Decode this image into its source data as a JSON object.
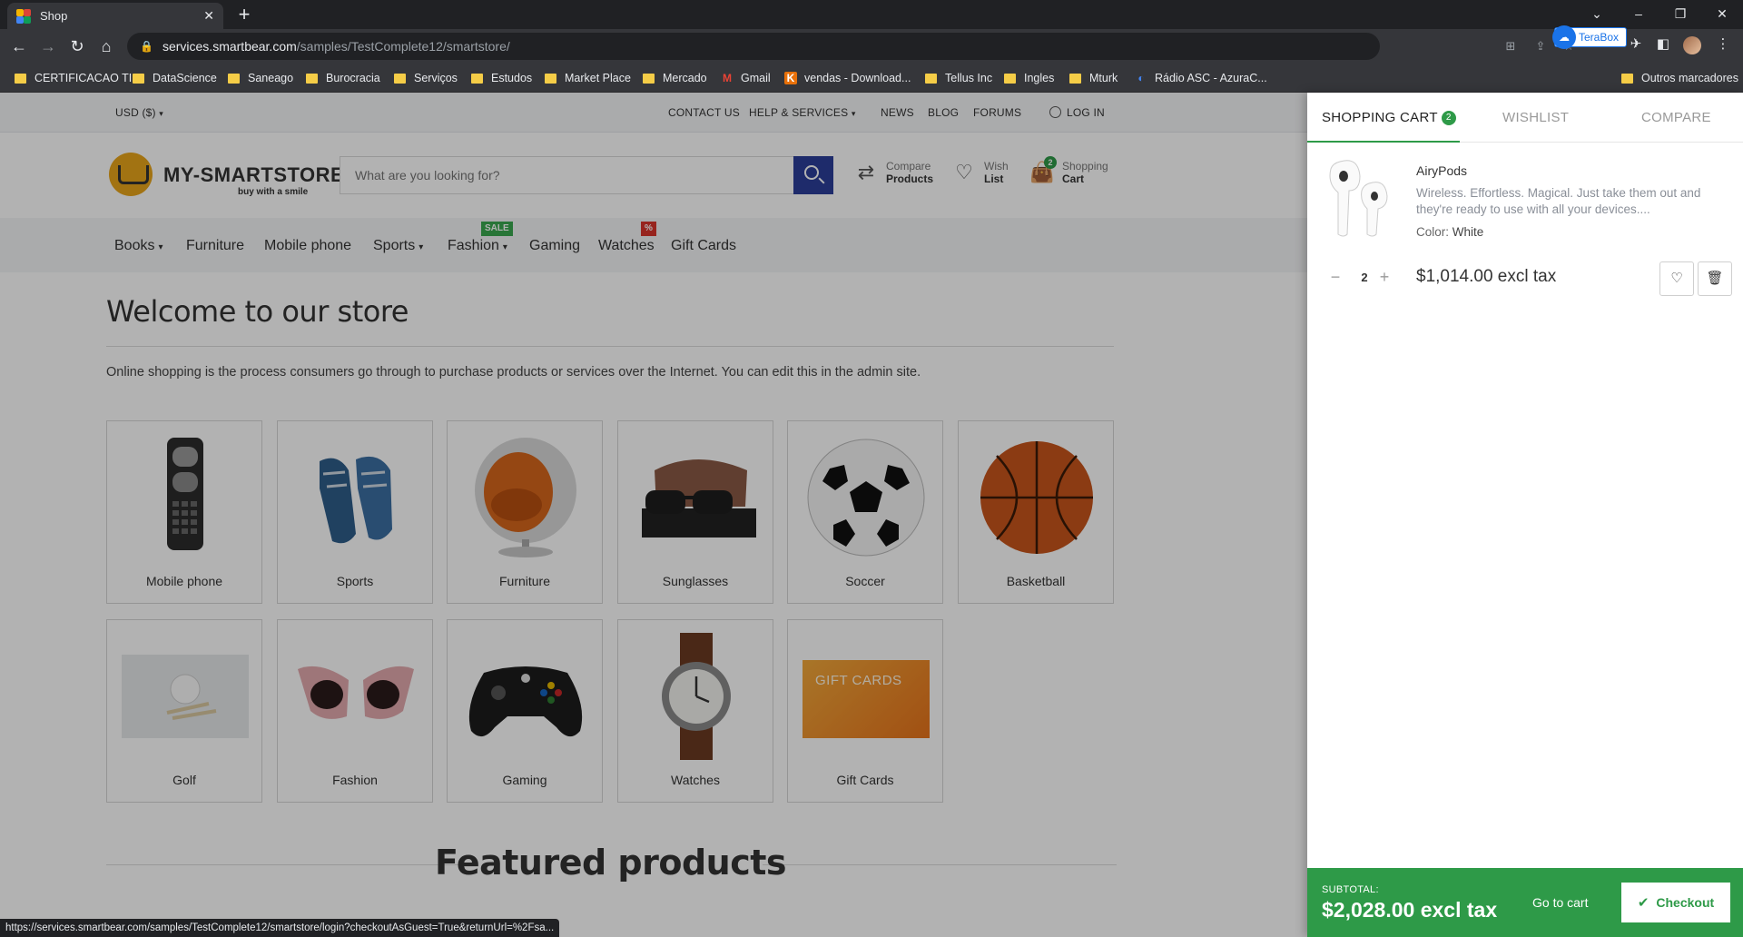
{
  "browser": {
    "tab_title": "Shop",
    "url_host": "services.smartbear.com",
    "url_path": "/samples/TestComplete12/smartstore/",
    "extension_label": "TeraBox",
    "bookmarks": [
      "CERTIFICACAO TI",
      "DataScience",
      "Saneago",
      "Burocracia",
      "Serviços",
      "Estudos",
      "Market Place",
      "Mercado",
      "Gmail",
      "vendas - Download...",
      "Tellus Inc",
      "Ingles",
      "Mturk",
      "Rádio ASC - AzuraC..."
    ],
    "other_bookmarks": "Outros marcadores",
    "status_url": "https://services.smartbear.com/samples/TestComplete12/smartstore/login?checkoutAsGuest=True&returnUrl=%2Fsa..."
  },
  "topbar": {
    "currency": "USD ($)",
    "contact": "CONTACT US",
    "help": "HELP & SERVICES",
    "news": "NEWS",
    "blog": "BLOG",
    "forums": "FORUMS",
    "login": "LOG IN"
  },
  "header": {
    "logo_text": "MY-SMARTSTORE",
    "logo_sub": "buy with a smile",
    "search_placeholder": "What are you looking for?",
    "compare_l1": "Compare",
    "compare_l2": "Products",
    "wish_l1": "Wish",
    "wish_l2": "List",
    "cart_l1": "Shopping",
    "cart_l2": "Cart",
    "cart_badge": "2"
  },
  "nav": {
    "items": [
      "Books",
      "Furniture",
      "Mobile phone",
      "Sports",
      "Fashion",
      "Gaming",
      "Watches",
      "Gift Cards"
    ],
    "sale_flag": "SALE",
    "pct_flag": "%"
  },
  "content": {
    "welcome": "Welcome to our store",
    "intro": "Online shopping is the process consumers go through to purchase products or services over the Internet. You can edit this in the admin site.",
    "categories": [
      "Mobile phone",
      "Sports",
      "Furniture",
      "Sunglasses",
      "Soccer",
      "Basketball",
      "Golf",
      "Fashion",
      "Gaming",
      "Watches",
      "Gift Cards"
    ],
    "gift_card_text": "GIFT CARDS",
    "featured": "Featured products"
  },
  "cart": {
    "tab_cart": "SHOPPING CART",
    "tab_cart_count": "2",
    "tab_wishlist": "WISHLIST",
    "tab_compare": "COMPARE",
    "item": {
      "name": "AiryPods",
      "description": "Wireless. Effortless. Magical. Just take them out and they're ready to use with all your devices....",
      "color_label": "Color:",
      "color_value": "White",
      "quantity": "2",
      "price": "$1,014.00 excl tax"
    },
    "subtotal_label": "SUBTOTAL:",
    "subtotal_value": "$2,028.00 excl tax",
    "go_to_cart": "Go to cart",
    "checkout": "Checkout"
  },
  "colors": {
    "accent_green": "#2e9a48",
    "search_blue": "#2c3e9a",
    "sale_flag": "#3aa84f",
    "pct_flag": "#d9342b"
  }
}
